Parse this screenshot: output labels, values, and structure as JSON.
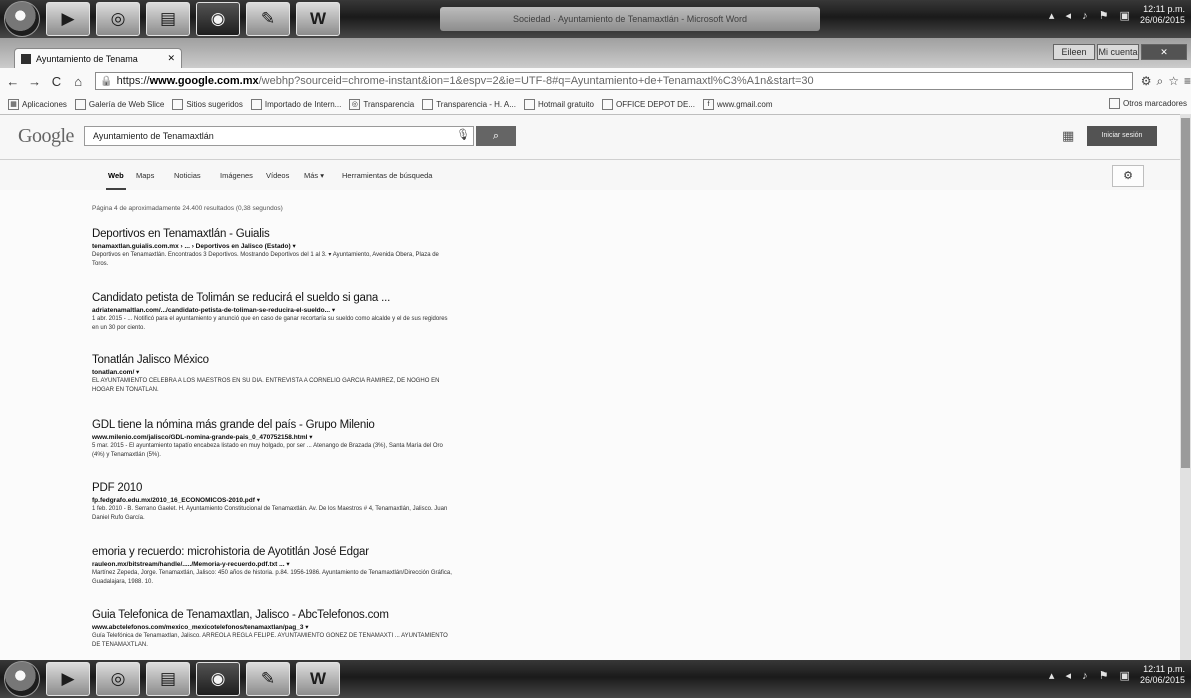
{
  "taskbar": {
    "buttons": [
      "",
      "",
      "",
      "",
      "",
      "",
      "W"
    ],
    "title": "Sociedad · Ayuntamiento de Tenamaxtlán - Microsoft Word",
    "clock_time": "12:11 p.m.",
    "clock_date": "26/06/2015"
  },
  "browser": {
    "tab_title": "Ayuntamiento de Tenama",
    "window_buttons": [
      "Eileen",
      "Mi cuenta",
      "✕"
    ],
    "url_scheme": "https://",
    "url_host": "www.google.com.mx",
    "url_rest": "/webhp?sourceid=chrome-instant&ion=1&espv=2&ie=UTF-8#q=Ayuntamiento+de+Tenamaxtl%C3%A1n&start=30",
    "bookmarks": [
      {
        "icon": "apps-icon",
        "label": "Aplicaciones"
      },
      {
        "icon": "page-icon",
        "label": "Galería de Web Slice"
      },
      {
        "icon": "page-icon",
        "label": "Sitios sugeridos"
      },
      {
        "icon": "folder-icon",
        "label": "Importado de Intern..."
      },
      {
        "icon": "globe-icon",
        "label": "Transparencia"
      },
      {
        "icon": "page-icon",
        "label": "Transparencia - H. A..."
      },
      {
        "icon": "page-icon",
        "label": "Hotmail gratuito"
      },
      {
        "icon": "page-icon",
        "label": "OFFICE DEPOT DE..."
      },
      {
        "icon": "facebook-icon",
        "label": "www.gmail.com"
      }
    ],
    "other_bookmarks": "Otros marcadores"
  },
  "google": {
    "logo": "Google",
    "query": "Ayuntamiento de Tenamaxtlán",
    "signin_label": "Iniciar sesión",
    "tabs": [
      "Web",
      "Maps",
      "Noticias",
      "Imágenes",
      "Vídeos",
      "Más ▾",
      "Herramientas de búsqueda"
    ],
    "stats": "Página 4 de aproximadamente 24.400 resultados (0,38 segundos)"
  },
  "results": [
    {
      "title": "Deportivos en Tenamaxtlán - Guialis",
      "url": "tenamaxtlan.guialis.com.mx › ... › Deportivos en Jalisco (Estado) ▾",
      "snippet": "Deportivos en Tenamaxtlán. Encontrados 3 Deportivos. Mostrando Deportivos del 1 al 3. ▾ Ayuntamiento, Avenida Obera, Plaza de Toros."
    },
    {
      "title": "Candidato petista de Tolimán se reducirá el sueldo si gana ...",
      "url": "adriatenamaltlan.com/.../candidato-petista-de-toliman-se-reducira-el-sueldo... ▾",
      "snippet": "1 abr. 2015 - ... Notificó para el ayuntamiento y anunció que en caso de ganar recortaría su sueldo como alcalde y el de sus regidores en un 30 por ciento."
    },
    {
      "title": "Tonatlán Jalisco México",
      "url": "tonatlan.com/ ▾",
      "snippet": "EL AYUNTAMIENTO CELEBRA A LOS MAESTROS EN SU DIA. ENTREVISTA A CORNELIO GARCIA RAMIREZ, DE NOGHO EN HOGAR EN TONATLAN."
    },
    {
      "title": "GDL tiene la nómina más grande del país - Grupo Milenio",
      "url": "www.milenio.com/jalisco/GDL-nomina-grande-pais_0_470752158.html ▾",
      "snippet": "5 mar. 2015 - El ayuntamiento tapatío encabeza listado en muy holgado, por ser ... Atenango de Brazada (3%), Santa María del Oro (4%) y Tenamaxtlán (5%)."
    },
    {
      "title": "PDF 2010",
      "url": "fp.fedgrafo.edu.mx/2010_16_ECONOMICOS-2010.pdf ▾",
      "snippet": "1 feb. 2010 - B. Serrano Gaelet. H. Ayuntamiento Constitucional de Tenamaxtlán. Av. De los Maestros # 4, Tenamaxtlán, Jalisco. Juan Daniel Rufo García."
    },
    {
      "title": "emoria y recuerdo: microhistoria de Ayotitlán José Edgar",
      "url": "rauleon.mx/bitstream/handle/...../Memoria-y-recuerdo.pdf.txt ... ▾",
      "snippet": "Martínez Zepeda, Jorge. Tenamaxtlán, Jalisco: 450 años de historia. p.84. 1956-1986. Ayuntamiento de Tenamaxtlán/Dirección Gráfica, Guadalajara, 1988. 10."
    },
    {
      "title": "Guia Telefonica de Tenamaxtlan, Jalisco - AbcTelefonos.com",
      "url": "www.abctelefonos.com/mexico_mexicotelefonos/tenamaxtlan/pag_3 ▾",
      "snippet": "Guía Telefónica de Tenamaxtlan, Jalisco. ARREOLA REGLA FELIPE. AYUNTAMIENTO GONEZ DE TENAMAXTI ... AYUNTAMIENTO DE TENAMAXTLAN."
    }
  ]
}
